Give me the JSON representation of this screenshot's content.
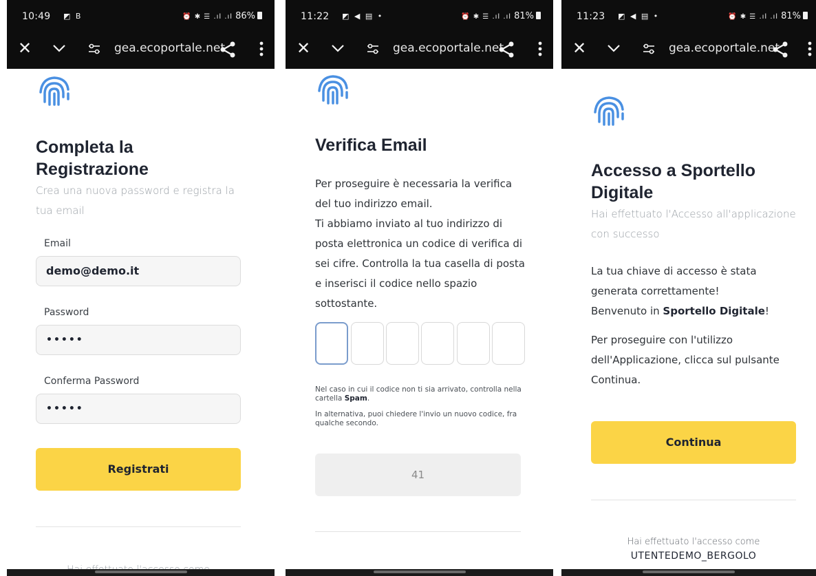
{
  "phone1": {
    "status": {
      "time": "10:49",
      "icons": "◩ B",
      "right_icons": "⏰ ✱ ☰ .ıl .ıl",
      "battery": "86%"
    },
    "url": {
      "host": "gea.ecoportale.net"
    },
    "title": "Completa la Registrazione",
    "subtitle": "Crea una nuova password e registra la tua email",
    "email_label": "Email",
    "email_value": "demo@demo.it",
    "password_label": "Password",
    "password_value": "•••••",
    "confirm_label": "Conferma Password",
    "confirm_value": "•••••",
    "button": "Registrati",
    "footer": "Hai effettuato l'accesso come"
  },
  "phone2": {
    "status": {
      "time": "11:22",
      "icons": "◩ ◀ ▤ •",
      "right_icons": "⏰ ✱ ☰ .ıl .ıl",
      "battery": "81%"
    },
    "url": {
      "host": "gea.ecoportale.net"
    },
    "title": "Verifica Email",
    "body_line1": "Per proseguire è necessaria la verifica del tuo indirizzo email.",
    "body_line2": "Ti abbiamo inviato al tuo indirizzo di posta elettronica un codice di verifica di sei cifre. Controlla la tua casella di posta e inserisci il codice nello spazio sottostante.",
    "note_pre": "Nel caso in cui il codice non ti sia arrivato, controlla nella cartella ",
    "note_bold": "Spam",
    "note_post": ".",
    "note_line2": "In alternativa, puoi chiedere l'invio un nuovo codice, fra qualche secondo.",
    "countdown": "41"
  },
  "phone3": {
    "status": {
      "time": "11:23",
      "icons": "◩ ◀ ▤ •",
      "right_icons": "⏰ ✱ ☰ .ıl .ıl",
      "battery": "81%"
    },
    "url": {
      "host": "gea.ecoportale.net"
    },
    "title": "Accesso a Sportello Digitale",
    "subtitle": "Hai effettuato l'Accesso all'applicazione con successo",
    "msg_line1": "La tua chiave di accesso è stata generata correttamente!",
    "msg_pre": "Benvenuto in ",
    "msg_bold": "Sportello Digitale",
    "msg_post": "!",
    "instructions": "Per proseguire con l'utilizzo dell'Applicazione, clicca sul pulsante Continua.",
    "button": "Continua",
    "footer": "Hai effettuato l'accesso come",
    "username": "UTENTEDEMO_BERGOLO"
  },
  "colors": {
    "accent_yellow": "#fbd446",
    "fingerprint_blue": "#4a90e2",
    "topbar": "#0d0d0d"
  }
}
